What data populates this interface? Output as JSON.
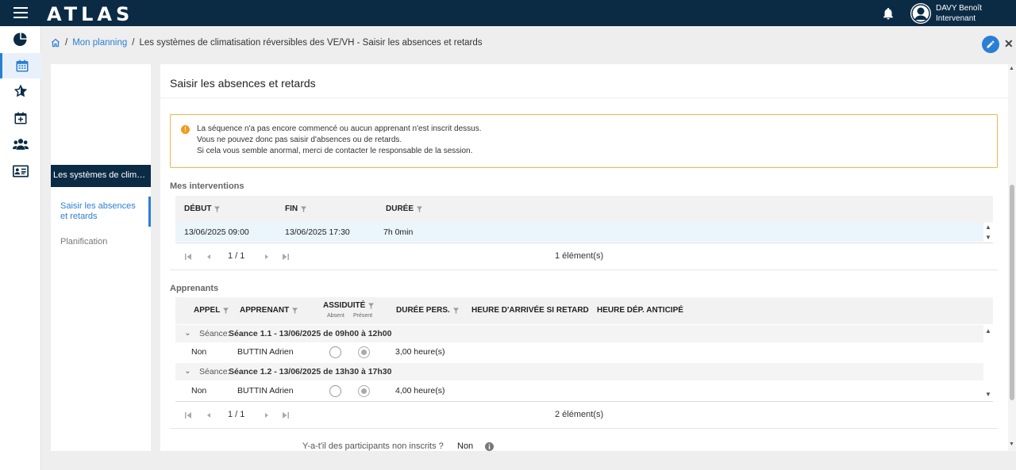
{
  "app": {
    "logo": "ATLAS"
  },
  "user": {
    "name": "DAVY Benoît",
    "role": "Intervenant"
  },
  "breadcrumb": {
    "planning": "Mon planning",
    "current": "Les systèmes de climatisation réversibles des VE/VH - Saisir les absences et retards",
    "sep": "/"
  },
  "left_panel": {
    "sequence_title": "Les systèmes de climatisation réversibles des VE/VH",
    "active_item": "Saisir les absences et retards",
    "item2": "Planification"
  },
  "main": {
    "title": "Saisir les absences et retards",
    "warning": {
      "line1": "La séquence n'a pas encore commencé ou aucun apprenant n'est inscrit dessus.",
      "line2": "Vous ne pouvez donc pas saisir d'absences ou de retards.",
      "line3": "Si cela vous semble anormal, merci de contacter le responsable de la session."
    }
  },
  "interventions": {
    "label": "Mes interventions",
    "columns": {
      "debut": "DÉBUT",
      "fin": "FIN",
      "duree": "DURÉE"
    },
    "rows": [
      {
        "debut": "13/06/2025 09:00",
        "fin": "13/06/2025 17:30",
        "duree": "7h 0min"
      }
    ],
    "pager": {
      "page": "1 / 1",
      "count": "1 élément(s)"
    }
  },
  "apprenants": {
    "label": "Apprenants",
    "columns": {
      "appel": "APPEL",
      "apprenant": "APPRENANT",
      "assiduite": "ASSIDUITÉ",
      "absent": "Absent",
      "present": "Présent",
      "duree": "DURÉE PERS.",
      "heure_arrivee": "HEURE D'ARRIVÉE SI RETARD",
      "heure_dep": "HEURE DÉP. ANTICIPÉ"
    },
    "groups": [
      {
        "prefix": "Séance:",
        "name": "Séance 1.1 - 13/06/2025 de 09h00 à 12h00",
        "row": {
          "appel": "Non",
          "apprenant": "BUTTIN Adrien",
          "assiduite": "present",
          "duree": "3,00 heure(s)"
        }
      },
      {
        "prefix": "Séance:",
        "name": "Séance 1.2 - 13/06/2025 de 13h30 à 17h30",
        "row": {
          "appel": "Non",
          "apprenant": "BUTTIN Adrien",
          "assiduite": "present",
          "duree": "4,00 heure(s)"
        }
      }
    ],
    "pager": {
      "page": "1 / 1",
      "count": "2 élément(s)"
    }
  },
  "participants_question": {
    "label": "Y-a-t'il des participants non inscrits ?",
    "value": "Non"
  },
  "colors": {
    "primary": "#0b2b45",
    "accent": "#2a7fd4",
    "warning": "#f0b54a"
  },
  "icons": [
    "menu-icon",
    "bell-icon",
    "user-avatar-icon",
    "chart-pie-icon",
    "calendar-icon",
    "star-icon",
    "calendar-plus-icon",
    "users-icon",
    "id-card-icon",
    "home-icon",
    "pencil-icon",
    "close-icon",
    "filter-icon",
    "info-icon"
  ]
}
